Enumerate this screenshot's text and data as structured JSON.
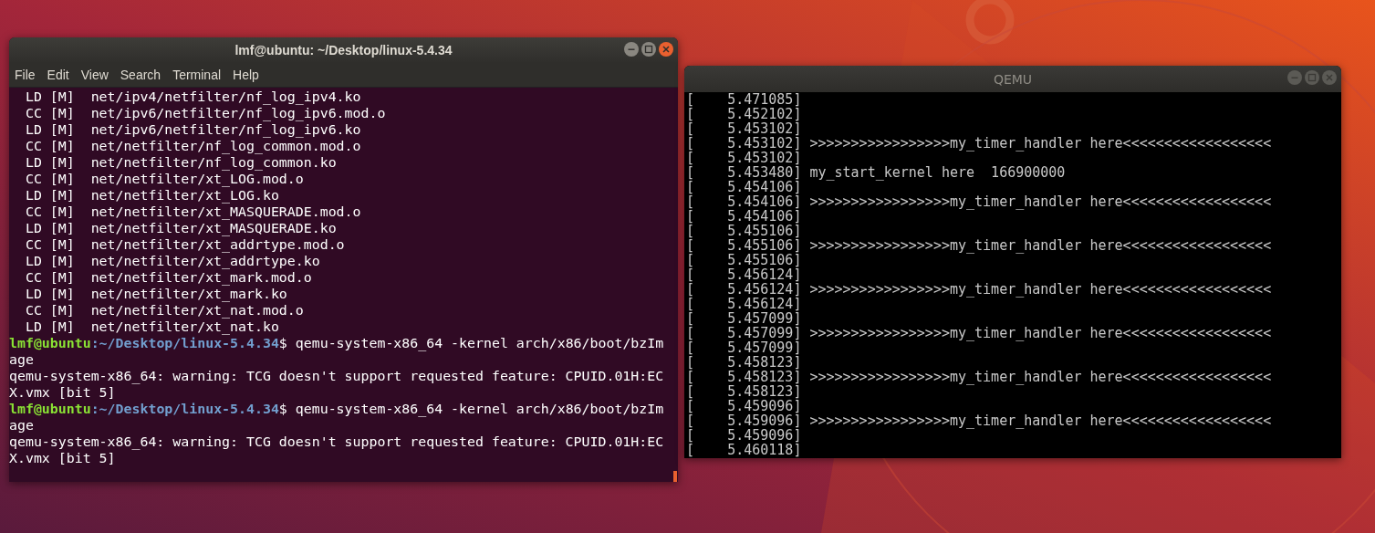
{
  "terminal": {
    "title": "lmf@ubuntu: ~/Desktop/linux-5.4.34",
    "active": true,
    "menu": [
      "File",
      "Edit",
      "View",
      "Search",
      "Terminal",
      "Help"
    ],
    "lines": [
      {
        "kind": "output",
        "text": "  LD [M]  net/ipv4/netfilter/nf_log_ipv4.ko"
      },
      {
        "kind": "output",
        "text": "  CC [M]  net/ipv6/netfilter/nf_log_ipv6.mod.o"
      },
      {
        "kind": "output",
        "text": "  LD [M]  net/ipv6/netfilter/nf_log_ipv6.ko"
      },
      {
        "kind": "output",
        "text": "  CC [M]  net/netfilter/nf_log_common.mod.o"
      },
      {
        "kind": "output",
        "text": "  LD [M]  net/netfilter/nf_log_common.ko"
      },
      {
        "kind": "output",
        "text": "  CC [M]  net/netfilter/xt_LOG.mod.o"
      },
      {
        "kind": "output",
        "text": "  LD [M]  net/netfilter/xt_LOG.ko"
      },
      {
        "kind": "output",
        "text": "  CC [M]  net/netfilter/xt_MASQUERADE.mod.o"
      },
      {
        "kind": "output",
        "text": "  LD [M]  net/netfilter/xt_MASQUERADE.ko"
      },
      {
        "kind": "output",
        "text": "  CC [M]  net/netfilter/xt_addrtype.mod.o"
      },
      {
        "kind": "output",
        "text": "  LD [M]  net/netfilter/xt_addrtype.ko"
      },
      {
        "kind": "output",
        "text": "  CC [M]  net/netfilter/xt_mark.mod.o"
      },
      {
        "kind": "output",
        "text": "  LD [M]  net/netfilter/xt_mark.ko"
      },
      {
        "kind": "output",
        "text": "  CC [M]  net/netfilter/xt_nat.mod.o"
      },
      {
        "kind": "output",
        "text": "  LD [M]  net/netfilter/xt_nat.ko"
      },
      {
        "kind": "prompt",
        "user_host": "lmf@ubuntu",
        "path": ":~/Desktop/linux-5.4.34",
        "command": "$ qemu-system-x86_64 -kernel arch/x86/boot/bzIm"
      },
      {
        "kind": "output",
        "text": "age"
      },
      {
        "kind": "output",
        "text": "qemu-system-x86_64: warning: TCG doesn't support requested feature: CPUID.01H:EC"
      },
      {
        "kind": "output",
        "text": "X.vmx [bit 5]"
      },
      {
        "kind": "prompt",
        "user_host": "lmf@ubuntu",
        "path": ":~/Desktop/linux-5.4.34",
        "command": "$ qemu-system-x86_64 -kernel arch/x86/boot/bzIm"
      },
      {
        "kind": "output",
        "text": "age"
      },
      {
        "kind": "output",
        "text": "qemu-system-x86_64: warning: TCG doesn't support requested feature: CPUID.01H:EC"
      },
      {
        "kind": "output",
        "text": "X.vmx [bit 5]"
      }
    ]
  },
  "qemu": {
    "title": "QEMU",
    "active": false,
    "lines": [
      {
        "time": "[    5.471085]"
      },
      {
        "time": "[    5.452102]"
      },
      {
        "time": "[    5.453102]"
      },
      {
        "time": "[    5.453102]",
        "message": ">>>>>>>>>>>>>>>>>my_timer_handler here<<<<<<<<<<<<<<<<<<"
      },
      {
        "time": "[    5.453102]"
      },
      {
        "time": "[    5.453480]",
        "message": "my_start_kernel here  166900000"
      },
      {
        "time": "[    5.454106]"
      },
      {
        "time": "[    5.454106]",
        "message": ">>>>>>>>>>>>>>>>>my_timer_handler here<<<<<<<<<<<<<<<<<<"
      },
      {
        "time": "[    5.454106]"
      },
      {
        "time": "[    5.455106]"
      },
      {
        "time": "[    5.455106]",
        "message": ">>>>>>>>>>>>>>>>>my_timer_handler here<<<<<<<<<<<<<<<<<<"
      },
      {
        "time": "[    5.455106]"
      },
      {
        "time": "[    5.456124]"
      },
      {
        "time": "[    5.456124]",
        "message": ">>>>>>>>>>>>>>>>>my_timer_handler here<<<<<<<<<<<<<<<<<<"
      },
      {
        "time": "[    5.456124]"
      },
      {
        "time": "[    5.457099]"
      },
      {
        "time": "[    5.457099]",
        "message": ">>>>>>>>>>>>>>>>>my_timer_handler here<<<<<<<<<<<<<<<<<<"
      },
      {
        "time": "[    5.457099]"
      },
      {
        "time": "[    5.458123]"
      },
      {
        "time": "[    5.458123]",
        "message": ">>>>>>>>>>>>>>>>>my_timer_handler here<<<<<<<<<<<<<<<<<<"
      },
      {
        "time": "[    5.458123]"
      },
      {
        "time": "[    5.459096]"
      },
      {
        "time": "[    5.459096]",
        "message": ">>>>>>>>>>>>>>>>>my_timer_handler here<<<<<<<<<<<<<<<<<<"
      },
      {
        "time": "[    5.459096]"
      },
      {
        "time": "[    5.460118]"
      }
    ]
  }
}
